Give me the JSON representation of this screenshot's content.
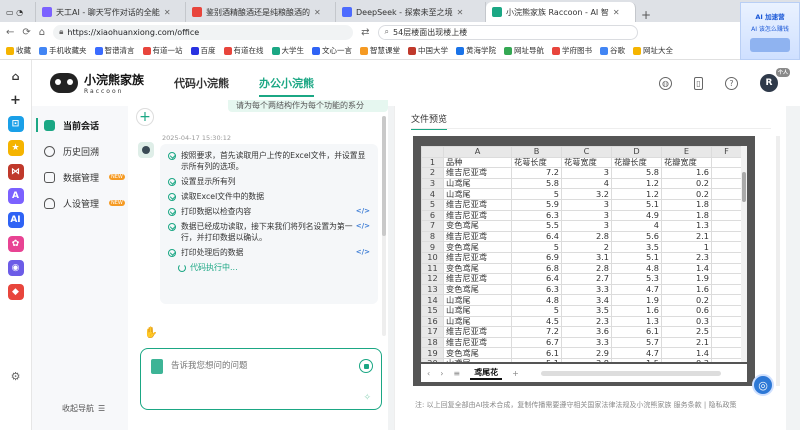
{
  "browser": {
    "tabs": [
      {
        "label": "天工AI - 聊天写作对话的全能",
        "color": "#7b61ff",
        "active": false
      },
      {
        "label": "鉴别酒精酿酒还是纯粮酿酒的",
        "color": "#e8453c",
        "active": false
      },
      {
        "label": "DeepSeek - 探索未至之境",
        "color": "#4d6bfe",
        "active": false
      },
      {
        "label": "小浣熊家族 Raccoon - AI 智",
        "color": "#1ba784",
        "active": true
      }
    ],
    "url": "https://xiaohuanxiong.com/office",
    "search_text": "54层楼面出现楼上楼",
    "bookmarks": [
      {
        "label": "收藏",
        "color": "#f5b400"
      },
      {
        "label": "手机收藏夹",
        "color": "#4285f4"
      },
      {
        "label": "智谱清言",
        "color": "#3b6cff"
      },
      {
        "label": "有道一站",
        "color": "#e8453c"
      },
      {
        "label": "百度",
        "color": "#2932e1"
      },
      {
        "label": "有道在线",
        "color": "#e8453c"
      },
      {
        "label": "大学生",
        "color": "#1ba784"
      },
      {
        "label": "文心一言",
        "color": "#2f63f5"
      },
      {
        "label": "智慧课堂",
        "color": "#f59a23"
      },
      {
        "label": "中国大学",
        "color": "#c0392b"
      },
      {
        "label": "黄海学院",
        "color": "#1a73e8"
      },
      {
        "label": "网址导航",
        "color": "#34a853"
      },
      {
        "label": "学府图书",
        "color": "#e8453c"
      },
      {
        "label": "谷歌",
        "color": "#4285f4"
      },
      {
        "label": "网址大全",
        "color": "#f5b400"
      }
    ],
    "ad": {
      "line1": "AI 加速营",
      "line2": "AI 该怎么赚钱"
    }
  },
  "header": {
    "brand_cn": "小浣熊家族",
    "brand_en": "Raccoon",
    "tab_code": "代码小浣熊",
    "tab_office": "办公小浣熊",
    "avatar_letter": "R",
    "avatar_badge": "个人"
  },
  "sidebar": {
    "items": [
      {
        "label": "当前会话",
        "active": true,
        "badge": ""
      },
      {
        "label": "历史回溯",
        "active": false,
        "badge": ""
      },
      {
        "label": "数据管理",
        "active": false,
        "badge": "NEW"
      },
      {
        "label": "人设管理",
        "active": false,
        "badge": "NEW"
      }
    ],
    "collapse_label": "收起导航"
  },
  "chat": {
    "user_message": "请为每个两结构作为每个功能的系分",
    "timestamp": "2025-04-17 15:30:12",
    "steps": [
      {
        "text": "按照要求，首先读取用户上传的Excel文件，并设置显示所有列的选项。",
        "code": false
      },
      {
        "text": "设置显示所有列",
        "code": false
      },
      {
        "text": "读取Excel文件中的数据",
        "code": false
      },
      {
        "text": "打印数据以检查内容",
        "code": true
      },
      {
        "text": "数据已经成功读取，接下来我们将列名设置为第一行，并打印数据以确认。",
        "code": true
      },
      {
        "text": "打印处理后的数据",
        "code": true
      }
    ],
    "executing": "代码执行中...",
    "input_placeholder": "告诉我您想问的问题"
  },
  "preview": {
    "tab_label": "文件预览",
    "sheet_name": "鸢尾花",
    "footer": "注: 以上回复全部由AI技术合成，复制传播需要遵守相关国家法律法规及小浣熊家族 服务条款 | 隐私政策",
    "columns": [
      "A",
      "B",
      "C",
      "D",
      "E",
      "F"
    ],
    "rows": [
      [
        "品种",
        "花萼长度",
        "花萼宽度",
        "花瓣长度",
        "花瓣宽度",
        ""
      ],
      [
        "维吉尼亚鸢",
        "7.2",
        "3",
        "5.8",
        "1.6",
        ""
      ],
      [
        "山鸢尾",
        "5.8",
        "4",
        "1.2",
        "0.2",
        ""
      ],
      [
        "山鸢尾",
        "5",
        "3.2",
        "1.2",
        "0.2",
        ""
      ],
      [
        "维吉尼亚鸢",
        "5.9",
        "3",
        "5.1",
        "1.8",
        ""
      ],
      [
        "维吉尼亚鸢",
        "6.3",
        "3",
        "4.9",
        "1.8",
        ""
      ],
      [
        "变色鸢尾",
        "5.5",
        "3",
        "4",
        "1.3",
        ""
      ],
      [
        "维吉尼亚鸢",
        "6.4",
        "2.8",
        "5.6",
        "2.1",
        ""
      ],
      [
        "变色鸢尾",
        "5",
        "2",
        "3.5",
        "1",
        ""
      ],
      [
        "维吉尼亚鸢",
        "6.9",
        "3.1",
        "5.1",
        "2.3",
        ""
      ],
      [
        "变色鸢尾",
        "6.8",
        "2.8",
        "4.8",
        "1.4",
        ""
      ],
      [
        "维吉尼亚鸢",
        "6.4",
        "2.7",
        "5.3",
        "1.9",
        ""
      ],
      [
        "变色鸢尾",
        "6.3",
        "3.3",
        "4.7",
        "1.6",
        ""
      ],
      [
        "山鸢尾",
        "4.8",
        "3.4",
        "1.9",
        "0.2",
        ""
      ],
      [
        "山鸢尾",
        "5",
        "3.5",
        "1.6",
        "0.6",
        ""
      ],
      [
        "山鸢尾",
        "4.5",
        "2.3",
        "1.3",
        "0.3",
        ""
      ],
      [
        "维吉尼亚鸢",
        "7.2",
        "3.6",
        "6.1",
        "2.5",
        ""
      ],
      [
        "维吉尼亚鸢",
        "6.7",
        "3.3",
        "5.7",
        "2.1",
        ""
      ],
      [
        "变色鸢尾",
        "6.1",
        "2.9",
        "4.7",
        "1.4",
        ""
      ],
      [
        "山鸢尾",
        "5.1",
        "3.8",
        "1.5",
        "0.3",
        ""
      ]
    ]
  }
}
